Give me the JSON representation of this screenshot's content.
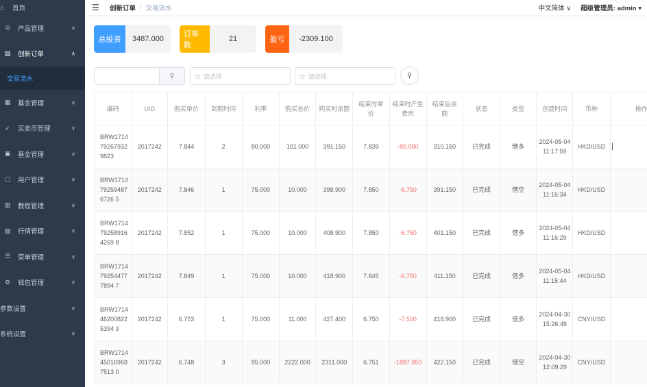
{
  "sidebar": {
    "items": [
      {
        "icon": "home-icon",
        "glyph": "⌂",
        "label": "首页",
        "arrow": false
      },
      {
        "icon": "product-icon",
        "glyph": "◎",
        "label": "产品管理",
        "arrow": true
      },
      {
        "icon": "order-icon",
        "glyph": "▤",
        "label": "创新订单",
        "arrow": true,
        "open": true
      },
      {
        "icon": "fund-icon",
        "glyph": "▦",
        "label": "基金管理",
        "arrow": true
      },
      {
        "icon": "trade-icon",
        "glyph": "✓",
        "label": "买卖币管理",
        "arrow": true
      },
      {
        "icon": "fund2-icon",
        "glyph": "▣",
        "label": "基金管理",
        "arrow": true
      },
      {
        "icon": "user-icon",
        "glyph": "☐",
        "label": "用户管理",
        "arrow": true
      },
      {
        "icon": "course-icon",
        "glyph": "▥",
        "label": "教程管理",
        "arrow": true
      },
      {
        "icon": "market-icon",
        "glyph": "▧",
        "label": "行情管理",
        "arrow": true
      },
      {
        "icon": "menu-icon",
        "glyph": "☰",
        "label": "菜单管理",
        "arrow": true
      },
      {
        "icon": "wallet-icon",
        "glyph": "⚙",
        "label": "钱包管理",
        "arrow": true
      },
      {
        "icon": "",
        "glyph": "",
        "label": "参数设置",
        "arrow": true
      },
      {
        "icon": "",
        "glyph": "",
        "label": "系统设置",
        "arrow": true
      }
    ],
    "sub_active": "交易流水"
  },
  "header": {
    "breadcrumb_1": "创新订单",
    "breadcrumb_sep": "/",
    "breadcrumb_2": "交易流水",
    "language": "中文简体",
    "user": "超级管理员: admin"
  },
  "stats": {
    "total_invest_label": "总投资",
    "total_invest_value": "3487.000",
    "order_count_label": "订单数",
    "order_count_value": "21",
    "pnl_label": "盈亏",
    "pnl_value": "-2309.100"
  },
  "filters": {
    "search_placeholder": "",
    "date_start_placeholder": "请选择",
    "date_end_placeholder": "请选择"
  },
  "table": {
    "headers": [
      "编码",
      "UID",
      "购买单价",
      "到期时间",
      "利率",
      "购买总价",
      "购买时余额",
      "结束时单价",
      "结束时产生费用",
      "结束后余额",
      "状态",
      "类型",
      "创建时间",
      "币种",
      "操作"
    ],
    "rows": [
      [
        "BRW1714792679329823",
        "2017242",
        "7.844",
        "2",
        "80.000",
        "101.000",
        "391.150",
        "7.839",
        "-80.000",
        "310.150",
        "已完成",
        "借多",
        "2024-05-04 11:17:59",
        "HKD/USD"
      ],
      [
        "BRW1714792594876726 5",
        "2017242",
        "7.846",
        "1",
        "75.000",
        "10.000",
        "398.900",
        "7.850",
        "-6.750",
        "391.150",
        "已完成",
        "借空",
        "2024-05-04 11:16:34",
        "HKD/USD"
      ],
      [
        "BRW1714792589164269 8",
        "2017242",
        "7.852",
        "1",
        "75.000",
        "10.000",
        "408.900",
        "7.850",
        "-6.750",
        "401.150",
        "已完成",
        "借多",
        "2024-05-04 11:16:29",
        "HKD/USD"
      ],
      [
        "BRW1714792544777894 7",
        "2017242",
        "7.849",
        "1",
        "75.000",
        "10.000",
        "418.900",
        "7.845",
        "-6.750",
        "411.150",
        "已完成",
        "借多",
        "2024-05-04 11:15:44",
        "HKD/USD"
      ],
      [
        "BRW1714462008225394 3",
        "2017242",
        "6.753",
        "1",
        "75.000",
        "11.000",
        "427.400",
        "6.750",
        "-7.500",
        "418.900",
        "已完成",
        "借多",
        "2024-04-30 15:26:48",
        "CNY/USD"
      ],
      [
        "BRW1714450169687513 0",
        "2017242",
        "6.748",
        "3",
        "85.000",
        "2222.000",
        "2311.000",
        "6.751",
        "-1887.850",
        "422.150",
        "已完成",
        "借空",
        "2024-04-30 12:09:29",
        "CNY/USD"
      ]
    ]
  },
  "colors": {
    "sidebar_bg": "#2d3a4b",
    "accent": "#409eff",
    "orders": "#ffba00",
    "pnl": "#ff6412",
    "negative": "#f56c6c"
  }
}
